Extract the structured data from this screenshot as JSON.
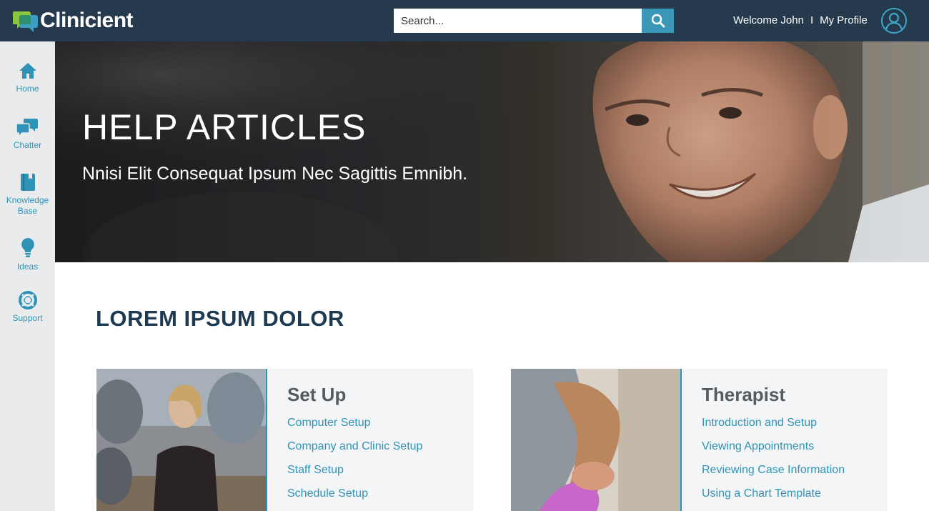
{
  "header": {
    "logo_text": "Clinicient",
    "search": {
      "placeholder": "Search...",
      "value": ""
    },
    "welcome_text": "Welcome John",
    "separator": "I",
    "profile_link": "My Profile"
  },
  "sidebar": {
    "items": [
      {
        "label": "Home",
        "icon": "home-icon"
      },
      {
        "label": "Chatter",
        "icon": "chat-bubbles-icon"
      },
      {
        "label": "Knowledge Base",
        "icon": "book-icon"
      },
      {
        "label": "Ideas",
        "icon": "lightbulb-icon"
      },
      {
        "label": "Support",
        "icon": "lifebuoy-icon"
      }
    ]
  },
  "hero": {
    "title": "HELP ARTICLES",
    "subtitle": "Nnisi Elit Consequat Ipsum Nec Sagittis Emnibh."
  },
  "main": {
    "section_title": "LOREM IPSUM DOLOR",
    "cards": [
      {
        "title": "Set Up",
        "links": [
          "Computer Setup",
          "Company and Clinic Setup",
          "Staff Setup",
          "Schedule Setup"
        ]
      },
      {
        "title": "Therapist",
        "links": [
          "Introduction and Setup",
          "Viewing Appointments",
          "Reviewing Case Information",
          "Using a Chart Template"
        ]
      }
    ]
  },
  "colors": {
    "header_bg": "#263a4d",
    "accent": "#2f93b7",
    "search_button": "#3a97b8",
    "sidebar_bg": "#e9ebec",
    "heading": "#1e3a52",
    "card_bg": "#f4f5f6"
  }
}
